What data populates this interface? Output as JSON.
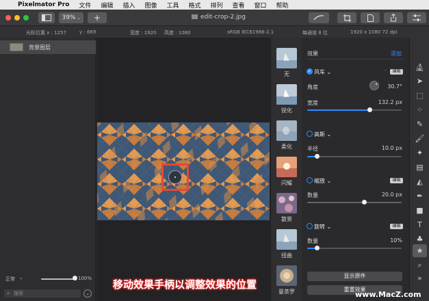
{
  "menubar": {
    "app_name": "Pixelmator Pro",
    "items": [
      "文件",
      "编辑",
      "插入",
      "图像",
      "工具",
      "格式",
      "排列",
      "查看",
      "窗口",
      "帮助"
    ]
  },
  "toolbar": {
    "zoom": "39%",
    "document_title": "edit-crop-2.jpg"
  },
  "infobar": {
    "cursor_label": "光标位置 x : 1257",
    "cursor_y": "y : 669",
    "width": "宽度 : 1920",
    "height": "高度 : 1080",
    "color_profile": "sRGB IEC61966-2.1",
    "bit_depth": "每通道 8 位",
    "image_size": "1920 x 1080 72 dpi"
  },
  "layers": {
    "items": [
      {
        "name": "背景图层"
      }
    ],
    "blend_mode": "正常",
    "opacity": "100%",
    "opacity_fraction": 1.0,
    "search_placeholder": "搜索"
  },
  "effect_thumbs": [
    {
      "label": "无"
    },
    {
      "label": "锐化"
    },
    {
      "label": "柔化"
    },
    {
      "label": "闪耀"
    },
    {
      "label": "散景"
    },
    {
      "label": "扭曲"
    },
    {
      "label": "曼荼罗"
    }
  ],
  "effects": {
    "header": "效果",
    "add_label": "添加",
    "items": [
      {
        "name": "风车",
        "enabled": true,
        "badge": "编辑",
        "params": [
          {
            "label": "角度",
            "value": "30.7°"
          },
          {
            "label": "宽度",
            "value": "132.2 px",
            "fraction": 0.66
          }
        ]
      },
      {
        "name": "高斯",
        "enabled": false,
        "params": [
          {
            "label": "半径",
            "value": "10.0 px",
            "fraction": 0.1
          }
        ]
      },
      {
        "name": "缩放",
        "enabled": false,
        "badge": "编辑",
        "params": [
          {
            "label": "数量",
            "value": "20.0 px",
            "fraction": 0.6
          }
        ]
      },
      {
        "name": "旋转",
        "enabled": false,
        "badge": "编辑",
        "params": [
          {
            "label": "数量",
            "value": "10%",
            "fraction": 0.1
          }
        ]
      }
    ],
    "show_original_label": "显示原件",
    "reset_label": "重置效果"
  },
  "overlay": {
    "caption": "移动效果手柄以调整效果的位置",
    "watermark": "www.MacZ.com"
  },
  "colors": {
    "accent": "#2f8cff",
    "handle_box": "#e8463a",
    "pattern_orange": "#e39a52",
    "pattern_blue": "#3e5876"
  }
}
